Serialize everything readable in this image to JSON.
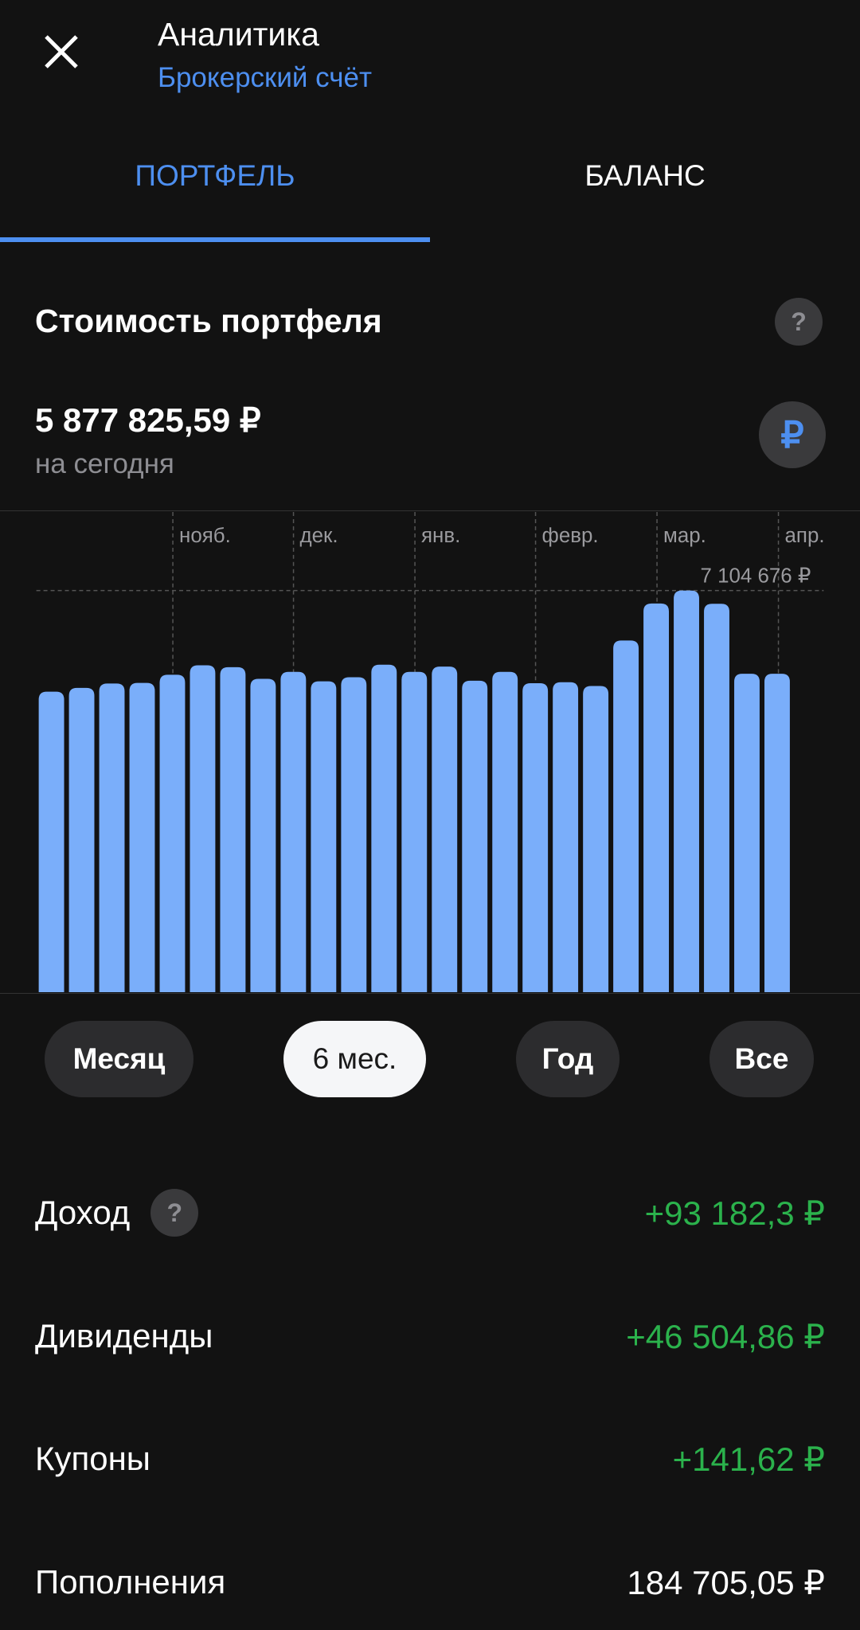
{
  "header": {
    "title": "Аналитика",
    "subtitle": "Брокерский счёт",
    "close_icon": "close-icon"
  },
  "tabs": [
    {
      "label": "ПОРТФЕЛЬ",
      "active": true
    },
    {
      "label": "БАЛАНС",
      "active": false
    }
  ],
  "portfolio": {
    "title": "Стоимость портфеля",
    "help": "?",
    "value": "5 877 825,59  ₽",
    "value_caption": "на сегодня",
    "currency_symbol": "₽"
  },
  "chart_data": {
    "type": "bar",
    "month_labels": [
      "нояб.",
      "дек.",
      "янв.",
      "февр.",
      "мар.",
      "апр."
    ],
    "max_label": "7 104 676 ₽",
    "max_value": 7104676,
    "values": [
      5316000,
      5383000,
      5461000,
      5472000,
      5616000,
      5783000,
      5749000,
      5544000,
      5666000,
      5499000,
      5572000,
      5794000,
      5666000,
      5760000,
      5510000,
      5666000,
      5466000,
      5483000,
      5416000,
      6221000,
      6877000,
      7104676,
      6871000,
      5633000,
      5633000
    ],
    "ylim": [
      0,
      7104676
    ],
    "grid": "vertical dashed at month starts, horizontal dashed at max",
    "bar_color": "#7aaefa"
  },
  "periods": [
    {
      "label": "Месяц",
      "selected": false
    },
    {
      "label": "6 мес.",
      "selected": true
    },
    {
      "label": "Год",
      "selected": false
    },
    {
      "label": "Все",
      "selected": false
    }
  ],
  "stats": [
    {
      "label": "Доход",
      "value": "+93 182,3 ₽",
      "help": "?",
      "positive": true
    },
    {
      "label": "Дивиденды",
      "value": "+46 504,86 ₽",
      "positive": true
    },
    {
      "label": "Купоны",
      "value": "+141,62 ₽",
      "positive": true
    },
    {
      "label": "Пополнения",
      "value": "184 705,05 ₽",
      "positive": false
    }
  ],
  "colors": {
    "accent": "#4d8ff0",
    "positive": "#2bb24c",
    "background": "#121212"
  }
}
